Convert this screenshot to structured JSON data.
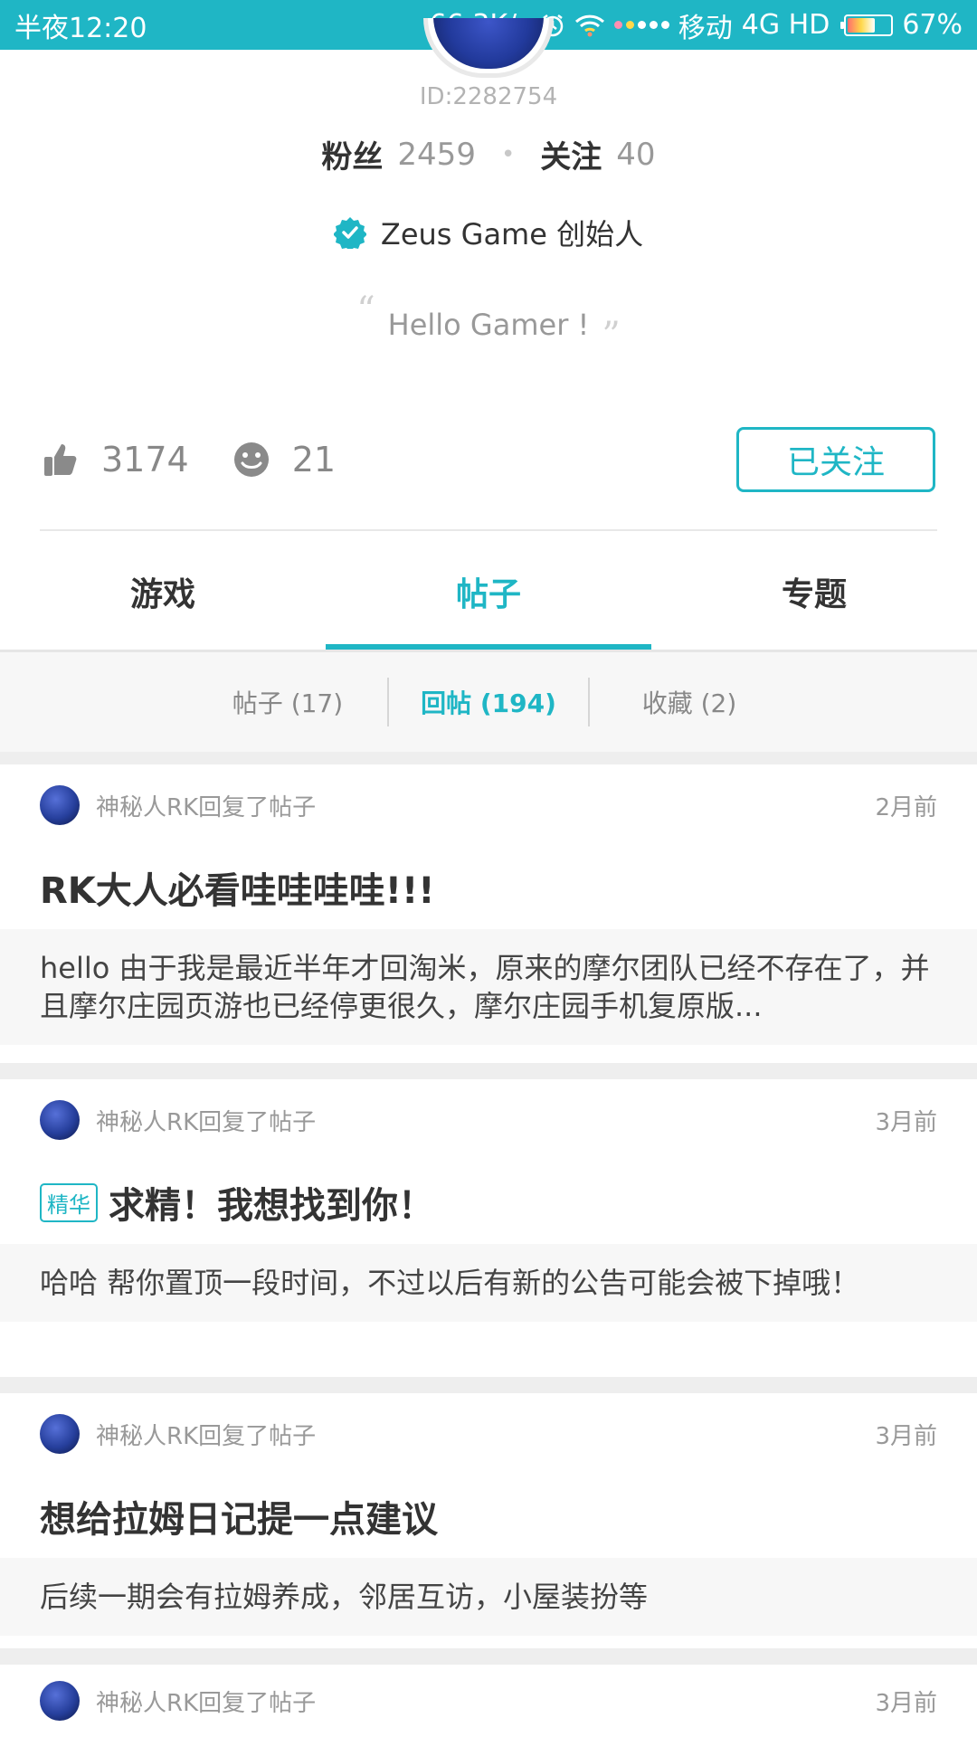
{
  "status_bar": {
    "time": "半夜12:20",
    "speed": "66.3K/s",
    "carrier": "移动",
    "network": "4G HD",
    "battery": "67%"
  },
  "profile": {
    "id": "ID:2282754",
    "fans_label": "粉丝",
    "fans_count": "2459",
    "follow_label": "关注",
    "follow_count": "40",
    "verified_title": "Zeus Game 创始人",
    "bio": "Hello Gamer !",
    "likes": "3174",
    "emotes": "21",
    "follow_button": "已关注"
  },
  "tabs": [
    {
      "label": "游戏"
    },
    {
      "label": "帖子"
    },
    {
      "label": "专题"
    }
  ],
  "sub_tabs": [
    {
      "label": "帖子 (17)"
    },
    {
      "label": "回帖 (194)"
    },
    {
      "label": "收藏 (2)"
    }
  ],
  "posts": [
    {
      "meta": "神秘人RK回复了帖子",
      "time": "2月前",
      "badge": "",
      "title": "RK大人必看哇哇哇哇!!!",
      "body": "hello 由于我是最近半年才回淘米，原来的摩尔团队已经不存在了，并且摩尔庄园页游也已经停更很久，摩尔庄园手机复原版..."
    },
    {
      "meta": "神秘人RK回复了帖子",
      "time": "3月前",
      "badge": "精华",
      "title": "求精！我想找到你！",
      "body": "哈哈 帮你置顶一段时间，不过以后有新的公告可能会被下掉哦！"
    },
    {
      "meta": "神秘人RK回复了帖子",
      "time": "3月前",
      "badge": "",
      "title": "想给拉姆日记提一点建议",
      "body": "后续一期会有拉姆养成，邻居互访，小屋装扮等"
    },
    {
      "meta": "神秘人RK回复了帖子",
      "time": "3月前"
    }
  ],
  "colors": {
    "accent": "#1fb6c5",
    "verified": "#1fb6c5"
  }
}
